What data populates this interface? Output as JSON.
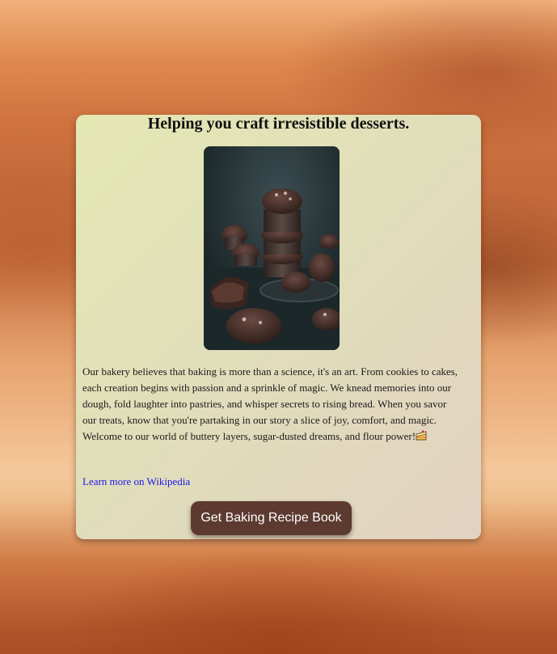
{
  "card": {
    "title": "Helping you craft irresistible desserts.",
    "image": {
      "subject": "stacked chocolate muffins on dark background"
    },
    "description": "Our bakery believes that baking is more than a science, it's an art. From cookies to cakes, each creation begins with passion and a sprinkle of magic. We knead memories into our dough, fold laughter into pastries, and whisper secrets to rising bread. When you savor our treats, know that you're partaking in our story a slice of joy, comfort, and magic. Welcome to our world of buttery layers, sugar-dusted dreams, and flour power!",
    "description_emoji": "cake-slice-emoji",
    "link_label": "Learn more on Wikipedia",
    "button_label": "Get Baking Recipe Book"
  },
  "colors": {
    "button_bg": "#5d3a2f",
    "button_text": "#ffffff",
    "link": "#1a1aee",
    "card_bg_start": "#e4e8b3",
    "card_bg_end": "#e2d2c0"
  }
}
